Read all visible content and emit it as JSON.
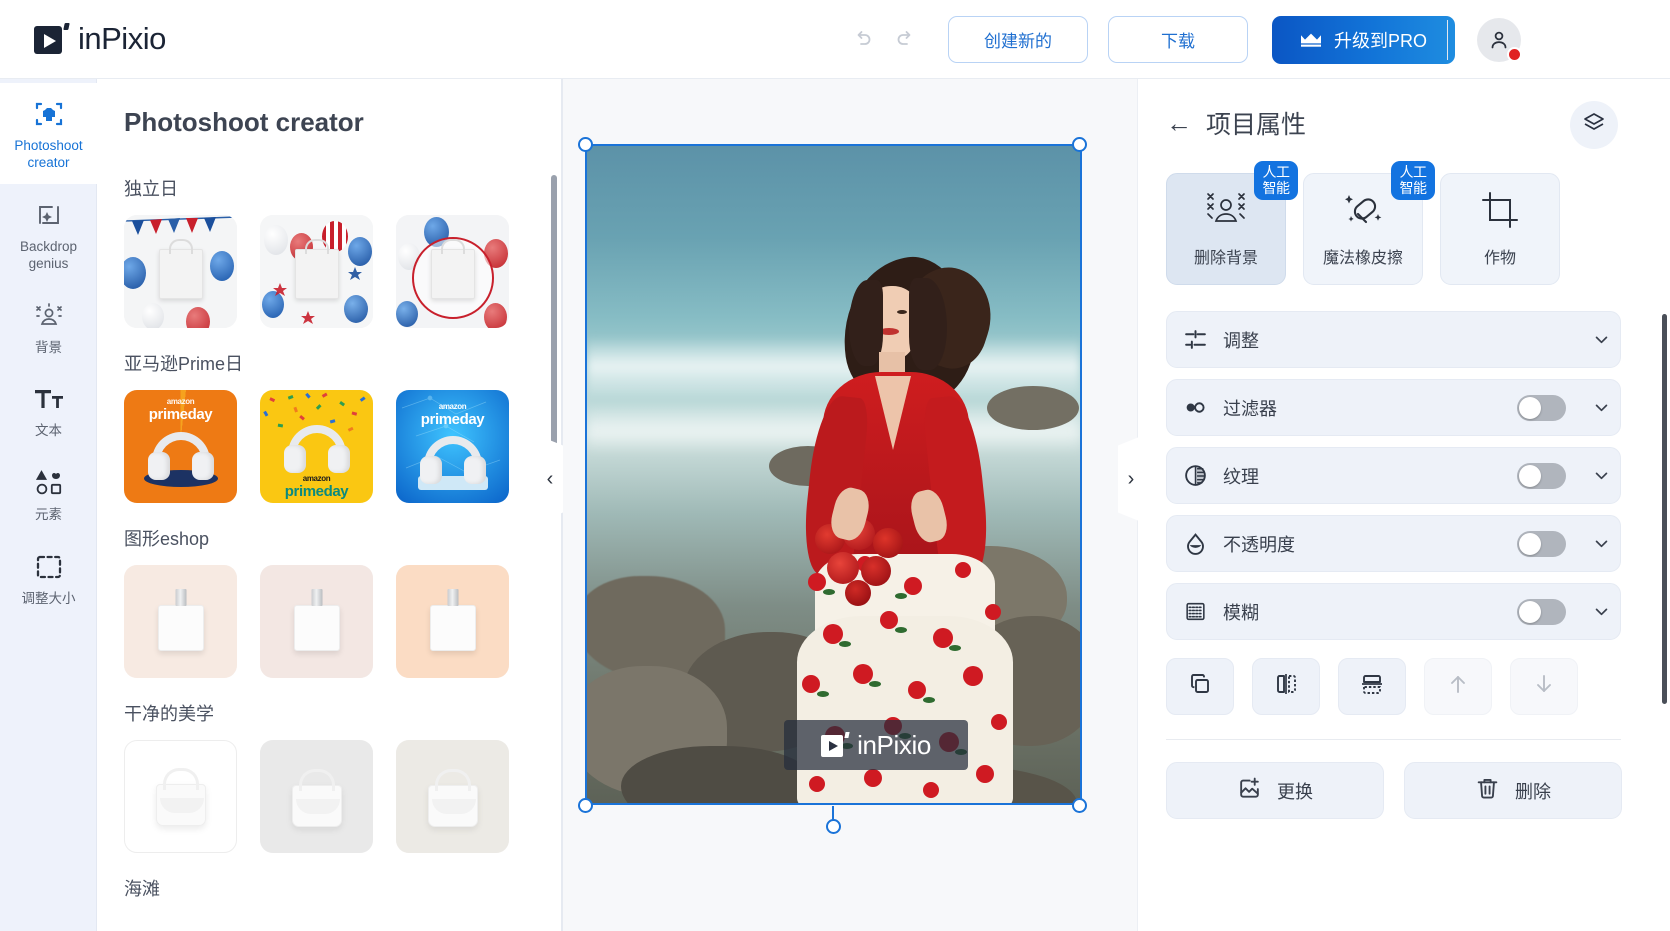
{
  "header": {
    "brand_name": "inPixio",
    "undo_icon": "undo-icon",
    "redo_icon": "redo-icon",
    "create_new_label": "创建新的",
    "download_label": "下载",
    "upgrade_label": "升级到PRO",
    "crown_icon": "crown-icon",
    "avatar_icon": "user-avatar-icon",
    "accent_blue": "#1274d8",
    "link_blue": "#1f6fd0"
  },
  "rail": {
    "items": [
      {
        "label": "Photoshoot creator",
        "icon": "photoshoot-creator-icon",
        "active": true
      },
      {
        "label": "Backdrop genius",
        "icon": "backdrop-genius-icon",
        "active": false
      },
      {
        "label": "背景",
        "icon": "background-icon",
        "active": false
      },
      {
        "label": "文本",
        "icon": "text-icon",
        "active": false
      },
      {
        "label": "元素",
        "icon": "elements-icon",
        "active": false
      },
      {
        "label": "调整大小",
        "icon": "resize-icon",
        "active": false
      }
    ]
  },
  "panel": {
    "title": "Photoshoot creator",
    "groups": [
      {
        "title": "独立日",
        "kind": "july4"
      },
      {
        "title": "亚马逊Prime日",
        "kind": "primeday"
      },
      {
        "title": "图形eshop",
        "kind": "perfume"
      },
      {
        "title": "干净的美学",
        "kind": "handbag"
      },
      {
        "title": "海滩",
        "kind": "beach"
      }
    ],
    "primeday_brand": "amazon",
    "primeday_label": "primeday"
  },
  "canvas": {
    "collapse_left_icon": "chevron-left-icon",
    "collapse_right_icon": "chevron-right-icon",
    "watermark_text": "inPixio",
    "selection_color": "#1a73d8"
  },
  "right": {
    "back_icon": "back-arrow-icon",
    "title": "项目属性",
    "layers_icon": "layers-icon",
    "ai_badge_line1": "人工",
    "ai_badge_line2": "智能",
    "ai_tools": [
      {
        "label": "删除背景",
        "icon": "remove-background-icon",
        "ai": true,
        "selected": true
      },
      {
        "label": "魔法橡皮擦",
        "icon": "magic-eraser-icon",
        "ai": true,
        "selected": false
      },
      {
        "label": "作物",
        "icon": "crop-icon",
        "ai": false,
        "selected": false
      }
    ],
    "properties": [
      {
        "label": "调整",
        "icon": "adjust-sliders-icon",
        "toggle": false,
        "toggle_on": false,
        "chevron": true
      },
      {
        "label": "过滤器",
        "icon": "filter-icon",
        "toggle": true,
        "toggle_on": false,
        "chevron": true
      },
      {
        "label": "纹理",
        "icon": "texture-icon",
        "toggle": true,
        "toggle_on": false,
        "chevron": true
      },
      {
        "label": "不透明度",
        "icon": "opacity-icon",
        "toggle": true,
        "toggle_on": false,
        "chevron": true
      },
      {
        "label": "模糊",
        "icon": "blur-icon",
        "toggle": true,
        "toggle_on": false,
        "chevron": true
      }
    ],
    "arrange": [
      {
        "icon": "duplicate-icon",
        "disabled": false
      },
      {
        "icon": "flip-horizontal-icon",
        "disabled": false
      },
      {
        "icon": "flip-vertical-icon",
        "disabled": false
      },
      {
        "icon": "move-up-icon",
        "disabled": true
      },
      {
        "icon": "move-down-icon",
        "disabled": true
      }
    ],
    "replace_label": "更换",
    "replace_icon": "replace-image-icon",
    "delete_label": "删除",
    "delete_icon": "trash-icon"
  }
}
